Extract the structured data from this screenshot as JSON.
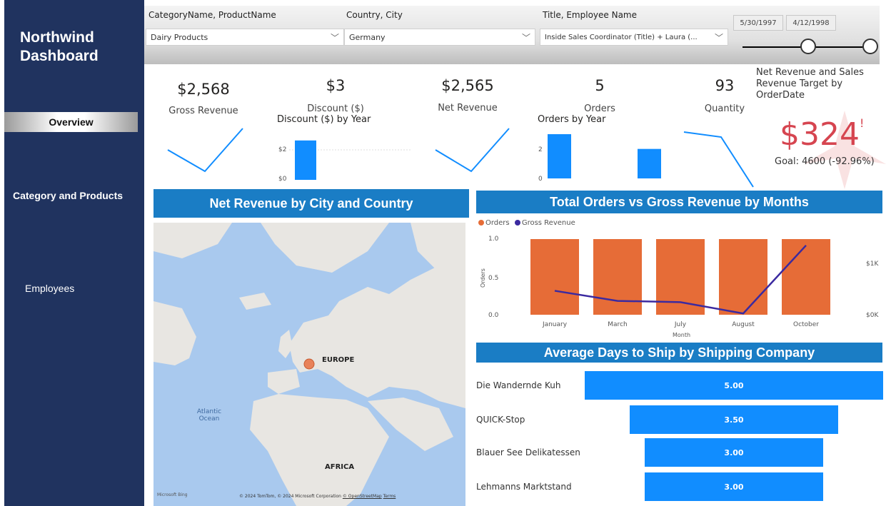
{
  "sidebar": {
    "title": "Northwind Dashboard",
    "nav": [
      {
        "label": "Overview",
        "active": true
      },
      {
        "label": "Category and Products",
        "active": false
      },
      {
        "label": "Employees",
        "active": false
      }
    ]
  },
  "filters": {
    "category": {
      "label": "CategoryName, ProductName",
      "value": "Dairy Products"
    },
    "country": {
      "label": "Country, City",
      "value": "Germany"
    },
    "employee": {
      "label": "Title, Employee Name",
      "value": "Inside Sales Coordinator (Title) + Laura (..."
    },
    "date_from": "5/30/1997",
    "date_to": "4/12/1998"
  },
  "kpis": {
    "gross_revenue": {
      "value": "$2,568",
      "label": "Gross Revenue"
    },
    "discount": {
      "value": "$3",
      "label": "Discount ($)",
      "chart_title": "Discount ($) by Year",
      "tick_top": "$2",
      "tick_bottom": "$0"
    },
    "net_revenue": {
      "value": "$2,565",
      "label": "Net Revenue"
    },
    "orders": {
      "value": "5",
      "label": "Orders",
      "chart_title": "Orders by Year",
      "tick_top": "2",
      "tick_bottom": "0"
    },
    "quantity": {
      "value": "93",
      "label": "Quantity"
    }
  },
  "target": {
    "title": "Net Revenue and Sales Revenue Target by OrderDate",
    "value": "$324",
    "alert": "!",
    "goal": "Goal: 4600 (-92.96%)"
  },
  "map_panel": {
    "title": "Net Revenue by City and Country",
    "labels": {
      "europe": "EUROPE",
      "africa": "AFRICA",
      "ocean": "Atlantic Ocean"
    },
    "logo": "Microsoft Bing",
    "copyright": "© 2024 TomTom, © 2024 Microsoft Corporation",
    "osm": "© OpenStreetMap",
    "terms": "Terms"
  },
  "orders_panel": {
    "title": "Total Orders vs Gross Revenue by Months",
    "legend": [
      "Orders",
      "Gross Revenue"
    ],
    "y_label": "Orders",
    "x_label": "Month",
    "left_ticks": [
      "1.0",
      "0.5",
      "0.0"
    ],
    "right_ticks": [
      "$1K",
      "$0K"
    ]
  },
  "ship_panel": {
    "title": "Average Days to Ship by Shipping Company"
  },
  "colors": {
    "sidebar": "#20335f",
    "panel_header": "#1a7dc5",
    "bar_blue": "#118dff",
    "orders_orange": "#e66c37",
    "revenue_navy": "#3b2aa0",
    "target_red": "#d64550"
  },
  "chart_data": [
    {
      "type": "bar",
      "title": "Discount ($) by Year",
      "categories": [
        "",
        ""
      ],
      "values": [
        2.3,
        0
      ],
      "ylim": [
        0,
        2.5
      ]
    },
    {
      "type": "bar",
      "title": "Orders by Year",
      "categories": [
        "",
        ""
      ],
      "values": [
        3,
        2
      ],
      "ylim": [
        0,
        3
      ]
    },
    {
      "type": "bar",
      "title": "Total Orders vs Gross Revenue by Months",
      "xlabel": "Month",
      "ylabel": "Orders",
      "categories": [
        "January",
        "March",
        "July",
        "August",
        "October"
      ],
      "series": [
        {
          "name": "Orders",
          "values": [
            1,
            1,
            1,
            1,
            1
          ]
        },
        {
          "name": "Gross Revenue",
          "values": [
            380,
            220,
            200,
            20,
            1100
          ]
        }
      ],
      "ylim": [
        0,
        1
      ],
      "y2lim": [
        0,
        1200
      ],
      "legend": "top-left"
    },
    {
      "type": "bar",
      "title": "Average Days to Ship by Shipping Company",
      "categories": [
        "Die Wandernde Kuh",
        "QUICK-Stop",
        "Blauer See Delikatessen",
        "Lehmanns Marktstand"
      ],
      "values": [
        5.0,
        3.5,
        3.0,
        3.0
      ],
      "labels": [
        "5.00",
        "3.50",
        "3.00",
        "3.00"
      ]
    }
  ]
}
